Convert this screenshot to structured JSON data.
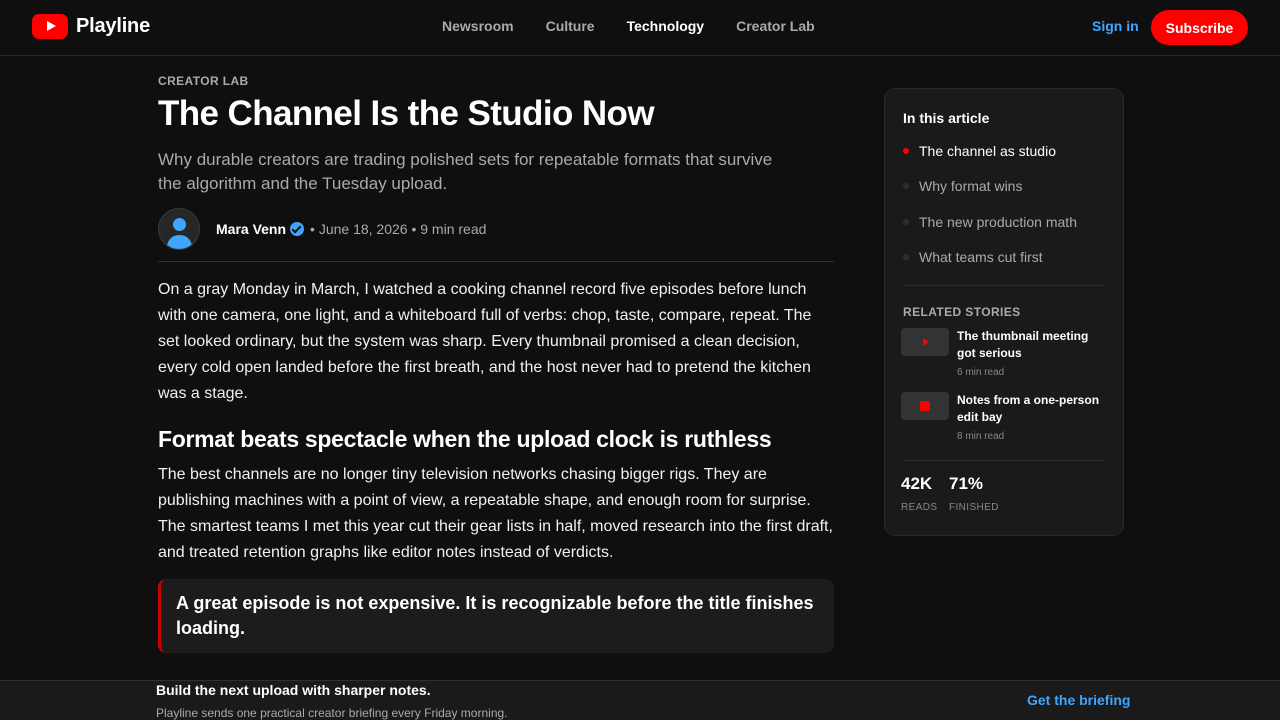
{
  "header": {
    "brand": "Playline",
    "nav": [
      {
        "label": "Newsroom",
        "active": false
      },
      {
        "label": "Culture",
        "active": false
      },
      {
        "label": "Technology",
        "active": true
      },
      {
        "label": "Creator Lab",
        "active": false
      }
    ],
    "signin_label": "Sign in",
    "subscribe_label": "Subscribe"
  },
  "article": {
    "kicker": "CREATOR LAB",
    "title": "The Channel Is the Studio Now",
    "dek": "Why durable creators are trading polished sets for repeatable formats that survive the algorithm and the Tuesday upload.",
    "author": "Mara Venn",
    "meta": "• June 18, 2026 • 9 min read",
    "paragraph_1": "On a gray Monday in March, I watched a cooking channel record five episodes before lunch with one camera, one light, and a whiteboard full of verbs: chop, taste, compare, repeat. The set looked ordinary, but the system was sharp. Every thumbnail promised a clean decision, every cold open landed before the first breath, and the host never had to pretend the kitchen was a stage.",
    "heading_2": "Format beats spectacle when the upload clock is ruthless",
    "paragraph_2": "The best channels are no longer tiny television networks chasing bigger rigs. They are publishing machines with a point of view, a repeatable shape, and enough room for surprise. The smartest teams I met this year cut their gear lists in half, moved research into the first draft, and treated retention graphs like editor notes instead of verdicts.",
    "pull_quote": "A great episode is not expensive. It is recognizable before the title finishes loading."
  },
  "sidebar": {
    "toc_title": "In this article",
    "toc": [
      {
        "label": "The channel as studio",
        "current": true
      },
      {
        "label": "Why format wins",
        "current": false
      },
      {
        "label": "The new production math",
        "current": false
      },
      {
        "label": "What teams cut first",
        "current": false
      }
    ],
    "related_title": "RELATED STORIES",
    "related": [
      {
        "title": "The thumbnail meeting got serious",
        "meta": "6 min read",
        "thumb_icon": "play-icon"
      },
      {
        "title": "Notes from a one-person edit bay",
        "meta": "8 min read",
        "thumb_icon": "stop-icon"
      }
    ],
    "stats": [
      {
        "value": "42K",
        "label": "READS"
      },
      {
        "value": "71%",
        "label": "FINISHED"
      }
    ]
  },
  "banner": {
    "title": "Build the next upload with sharper notes.",
    "subtitle": "Playline sends one practical creator briefing every Friday morning.",
    "cta": "Get the briefing"
  },
  "colors": {
    "accent": "#ff0000",
    "link": "#3ea6ff",
    "background": "#0f0f0f"
  }
}
